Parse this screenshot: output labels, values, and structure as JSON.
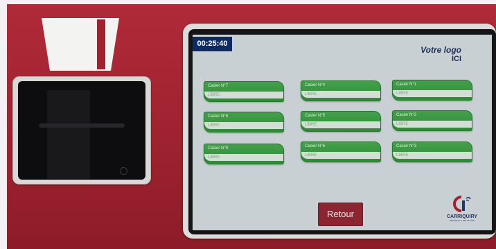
{
  "screen": {
    "timer": "00:25:40",
    "logo": {
      "line1": "Votre logo",
      "line2": "ICI"
    },
    "lockers": [
      {
        "name": "Casier N°7",
        "status": "LIBRE"
      },
      {
        "name": "Casier N°4",
        "status": "LIBRE"
      },
      {
        "name": "Casier N°1",
        "status": "LIBRE"
      },
      {
        "name": "Casier N°8",
        "status": "LIBRE"
      },
      {
        "name": "Casier N°5",
        "status": "LIBRE"
      },
      {
        "name": "Casier N°2",
        "status": "LIBRE"
      },
      {
        "name": "Casier N°9",
        "status": "LIBRE"
      },
      {
        "name": "Casier N°6",
        "status": "LIBRE"
      },
      {
        "name": "Casier N°3",
        "status": "LIBRE"
      }
    ],
    "back_button": "Retour",
    "brand": {
      "name": "CARRIQUIRY",
      "tagline": "SECURITY & SOLUTIONS"
    }
  },
  "colors": {
    "casing": "#a52635",
    "locker_green": "#3a9642",
    "timer_bg": "#0e2c62",
    "retour_bg": "#8b2631"
  },
  "icons": [
    "card-insert-icon",
    "carriquiry-logo-icon"
  ]
}
